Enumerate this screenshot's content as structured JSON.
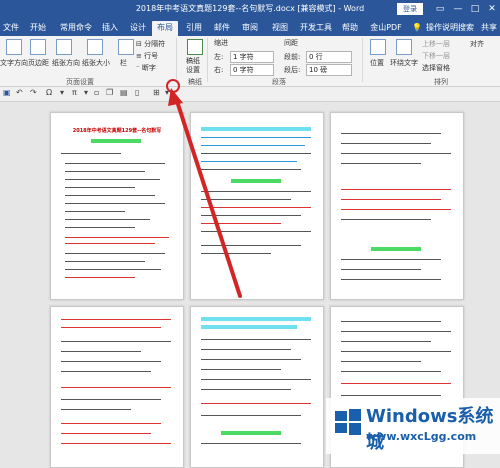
{
  "window": {
    "title": "2018年中考语文真题129套--名句默写.docx [兼容模式] - Word",
    "login": "登录",
    "minimize": "—",
    "restore": "□",
    "close": "✕"
  },
  "tabs": [
    "文件",
    "开始",
    "常用命令",
    "插入",
    "设计",
    "布局",
    "引用",
    "邮件",
    "审阅",
    "视图",
    "开发工具",
    "帮助",
    "金山PDF",
    "操作说明搜索",
    "共享"
  ],
  "active_tab": "布局",
  "ribbon": {
    "text_direction": "文字方向",
    "margins": "页边距",
    "orientation": "纸张方向",
    "size": "纸张大小",
    "columns": "栏",
    "breaks": "分隔符",
    "line_numbers": "行号",
    "hyphenation": "断字",
    "group_page_setup": "页面设置",
    "draft_settings_1": "稿纸",
    "draft_settings_2": "设置",
    "group_draft": "稿纸",
    "indent": "缩进",
    "spacing": "间距",
    "indent_left_label": "左:",
    "indent_left_value": "1 字符",
    "indent_right_label": "右:",
    "indent_right_value": "0 字符",
    "spacing_before_label": "段前:",
    "spacing_before_value": "0 行",
    "spacing_after_label": "段后:",
    "spacing_after_value": "10 磅",
    "group_paragraph": "段落",
    "position": "位置",
    "wrap_text": "环绕文字",
    "bring_forward": "上移一层",
    "send_backward": "下移一层",
    "selection_pane": "选择窗格",
    "align": "对齐",
    "group_arrange": "排列"
  },
  "document": {
    "page1_title": "2018年中考语文真题129套--名句默写"
  },
  "watermark": {
    "brand": "Windows系统城",
    "url": "www.wxcLgg.com"
  },
  "colors": {
    "title_bar": "#2b579a",
    "ribbon_bg": "#f3f3f3",
    "arrow": "#d32525"
  }
}
